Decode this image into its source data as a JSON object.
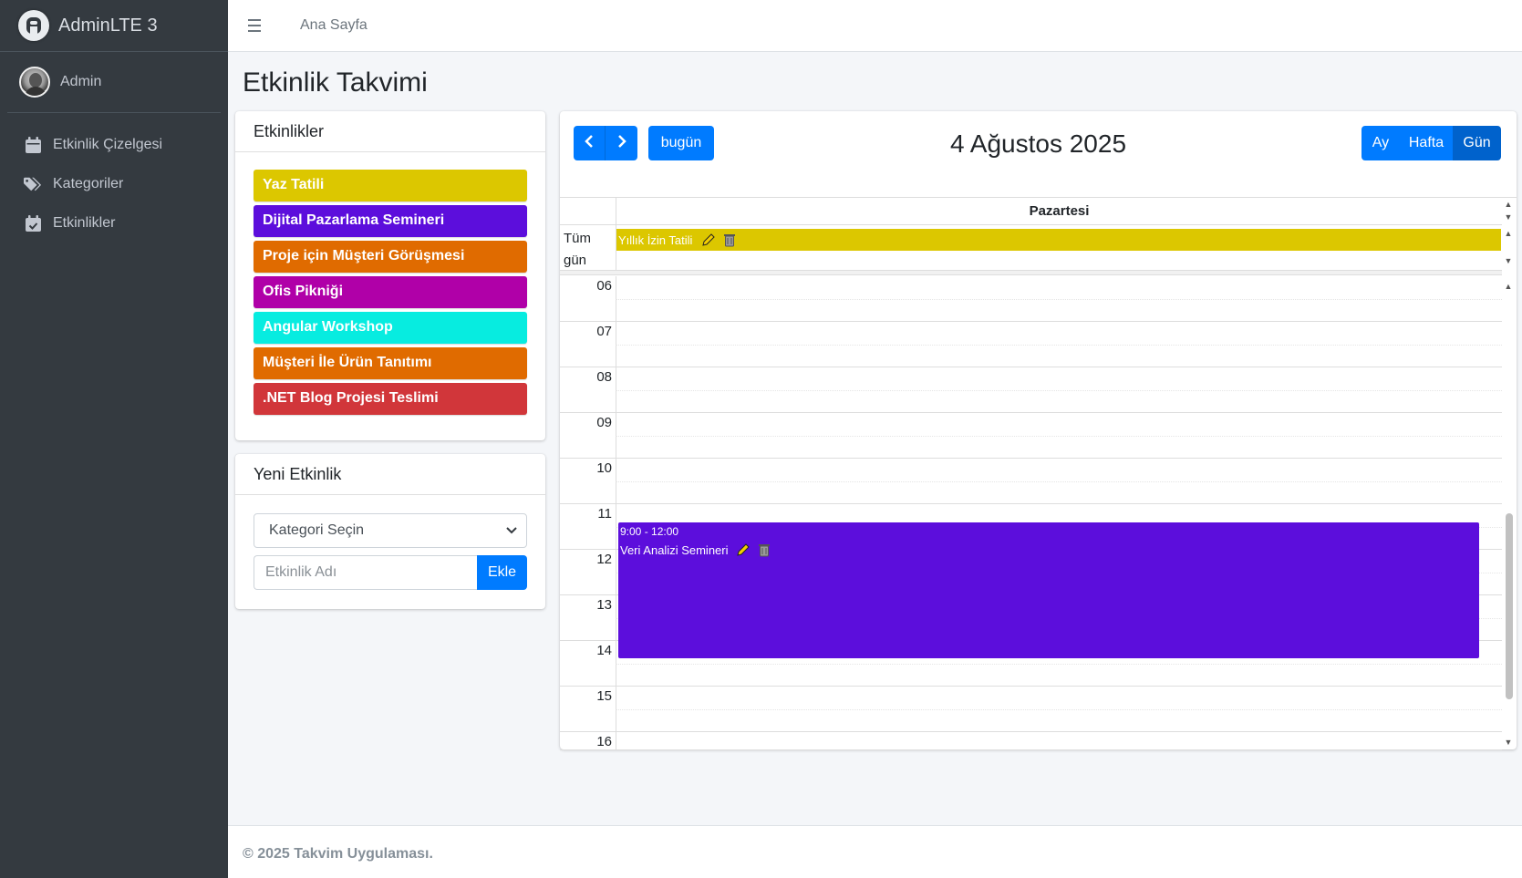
{
  "brand": {
    "name": "AdminLTE 3"
  },
  "user": {
    "name": "Admin"
  },
  "sidebar": {
    "items": [
      {
        "label": "Etkinlik Çizelgesi",
        "icon": "calendar-icon"
      },
      {
        "label": "Kategoriler",
        "icon": "tags-icon"
      },
      {
        "label": "Etkinlikler",
        "icon": "calendar-check-icon"
      }
    ]
  },
  "topbar": {
    "home_link": "Ana Sayfa"
  },
  "page": {
    "title": "Etkinlik Takvimi"
  },
  "events_card": {
    "title": "Etkinlikler",
    "items": [
      {
        "label": "Yaz Tatili",
        "color": "#dcc700"
      },
      {
        "label": "Dijital Pazarlama Semineri",
        "color": "#5c0edc"
      },
      {
        "label": "Proje için Müşteri Görüşmesi",
        "color": "#e06b00"
      },
      {
        "label": "Ofis Pikniği",
        "color": "#b000a8"
      },
      {
        "label": "Angular Workshop",
        "color": "#07ece0"
      },
      {
        "label": "Müşteri İle Ürün Tanıtımı",
        "color": "#e06b00"
      },
      {
        "label": ".NET Blog Projesi Teslimi",
        "color": "#d1363a"
      }
    ]
  },
  "new_event": {
    "title": "Yeni Etkinlik",
    "category_selected": "Kategori Seçin",
    "name_placeholder": "Etkinlik Adı",
    "add_label": "Ekle"
  },
  "calendar": {
    "title": "4 Ağustos 2025",
    "today_label": "bugün",
    "views": [
      "Ay",
      "Hafta",
      "Gün"
    ],
    "active_view": "Gün",
    "day_header": "Pazartesi",
    "allday_label_1": "Tüm",
    "allday_label_2": "gün",
    "allday_event": {
      "title": "Yıllık İzin Tatili",
      "color": "#dcc700"
    },
    "hours": [
      "06",
      "07",
      "08",
      "09",
      "10",
      "11",
      "12",
      "13",
      "14",
      "15",
      "16"
    ],
    "timed_event": {
      "time": "9:00 - 12:00",
      "title": "Veri Analizi Semineri",
      "color": "#5c0edc"
    }
  },
  "footer": {
    "text": "© 2025 Takvim Uygulaması."
  }
}
